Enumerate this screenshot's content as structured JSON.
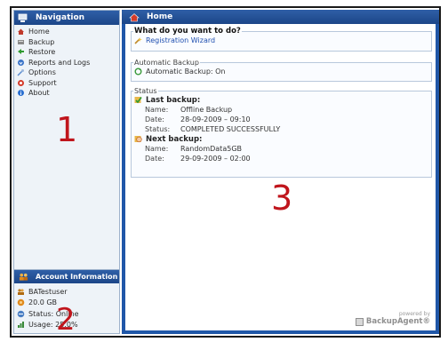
{
  "sidebar": {
    "title": "Navigation",
    "items": [
      {
        "label": "Home",
        "icon": "home-icon",
        "color": "#c0392b"
      },
      {
        "label": "Backup",
        "icon": "backup-icon",
        "color": "#7a7a7a"
      },
      {
        "label": "Restore",
        "icon": "restore-icon",
        "color": "#2e9a2e"
      },
      {
        "label": "Reports and Logs",
        "icon": "reports-icon",
        "color": "#3a74c8"
      },
      {
        "label": "Options",
        "icon": "options-icon",
        "color": "#5a8ccf"
      },
      {
        "label": "Support",
        "icon": "support-icon",
        "color": "#d43b2a"
      },
      {
        "label": "About",
        "icon": "about-icon",
        "color": "#2a6fd1"
      }
    ]
  },
  "account": {
    "title": "Account Information",
    "items": [
      {
        "label": "BATestuser",
        "icon": "user-icon",
        "color": "#c07a1d"
      },
      {
        "label": "20.0 GB",
        "icon": "storage-icon",
        "color": "#e08a1c"
      },
      {
        "label": "Status: Online",
        "icon": "status-icon",
        "color": "#4a7fc4"
      },
      {
        "label": "Usage: 25.0%",
        "icon": "usage-icon",
        "color": "#3a8a3a"
      }
    ]
  },
  "main": {
    "title": "Home",
    "what_to_do": {
      "legend": "What do you want to do?",
      "link": "Registration Wizard"
    },
    "auto_backup": {
      "legend": "Automatic Backup",
      "text": "Automatic Backup: On"
    },
    "status": {
      "legend": "Status",
      "last": {
        "title": "Last backup:",
        "name_label": "Name:",
        "name": "Offline Backup",
        "date_label": "Date:",
        "date": "28-09-2009 – 09:10",
        "status_label": "Status:",
        "status": "COMPLETED SUCCESSFULLY"
      },
      "next": {
        "title": "Next backup:",
        "name_label": "Name:",
        "name": "RandomData5GB",
        "date_label": "Date:",
        "date": "29-09-2009 – 02:00"
      }
    },
    "powered": {
      "small": "powered by",
      "brand": "BackupAgent®"
    }
  },
  "annotations": {
    "one": "1",
    "two": "2",
    "three": "3"
  },
  "colors": {
    "header_blue": "#2057a8",
    "annotation_red": "#c0151c"
  }
}
